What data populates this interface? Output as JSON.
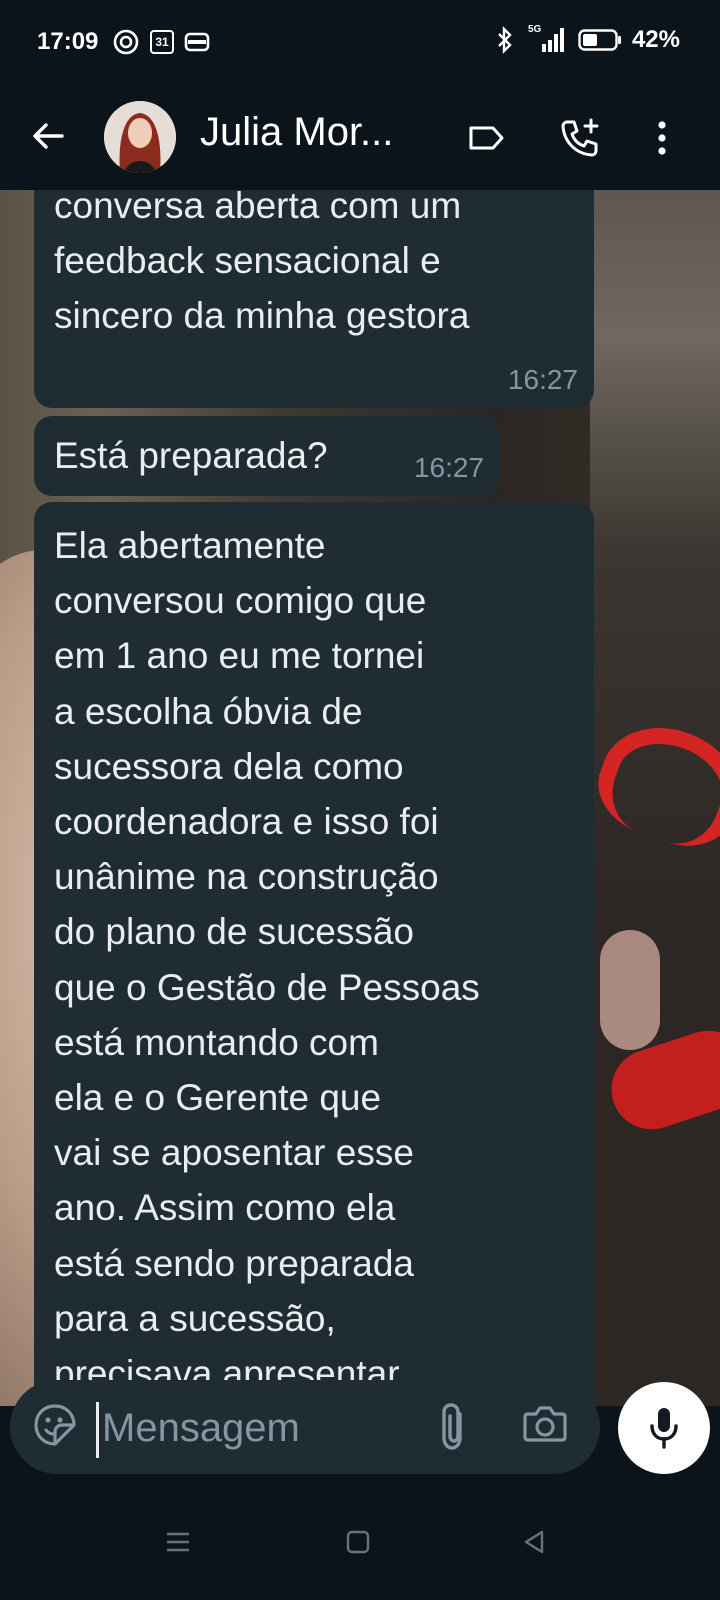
{
  "status_bar": {
    "time": "17:09",
    "calendar_day": "31",
    "network": "5G",
    "battery": "42%"
  },
  "header": {
    "contact_name": "Julia Mor..."
  },
  "messages": [
    {
      "text": "conversa aberta com um\nfeedback sensacional e\nsincero da minha gestora",
      "time": "16:27"
    },
    {
      "text": "Está preparada?",
      "time": "16:27"
    },
    {
      "text": "Ela abertamente\nconversou comigo que\nem 1 ano eu me tornei\na escolha óbvia de\nsucessora dela como\ncoordenadora e isso foi\nunânime na construção\ndo plano de sucessão\nque o Gestão de Pessoas\nestá montando com\nela e o Gerente que\nvai se aposentar esse\nano. Assim como ela\nestá sendo preparada\npara a sucessão,\nprecisava apresentar\no plano de sucessão",
      "time": ""
    }
  ],
  "composer": {
    "placeholder": "Mensagem"
  },
  "colors": {
    "bubble": "#202c33",
    "app_bg": "#0b141a",
    "timestamp": "#8696a0"
  },
  "icons": {
    "back": "arrow-left",
    "label": "label-tag",
    "call": "phone-plus",
    "menu": "more-vertical",
    "scroll": "chevron-double-down",
    "emoji": "sticker-smile",
    "attach": "paperclip",
    "camera": "camera",
    "mic": "microphone"
  }
}
